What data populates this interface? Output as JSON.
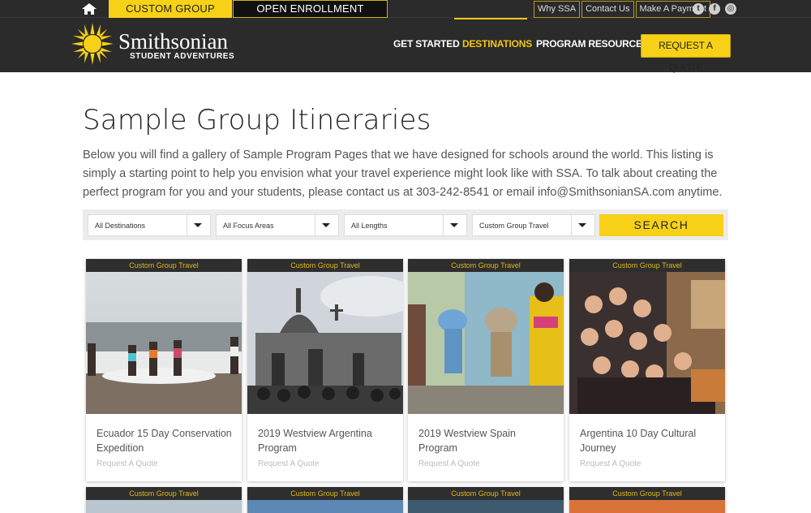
{
  "topbar": {
    "home_icon": "home-icon",
    "tab_custom": "CUSTOM GROUP TRAVEL",
    "tab_open": "OPEN ENROLLMENT PROGRAMS",
    "links": [
      "Why SSA",
      "Contact Us",
      "Make A Payment"
    ],
    "social": [
      {
        "name": "twitter-icon",
        "glyph": "t"
      },
      {
        "name": "facebook-icon",
        "glyph": "f"
      },
      {
        "name": "instagram-icon",
        "glyph": "◎"
      }
    ]
  },
  "header": {
    "logo_name": "Smithsonian",
    "logo_sub": "STUDENT ADVENTURES",
    "nav": [
      "GET STARTED",
      "DESTINATIONS",
      "PROGRAM RESOURCES"
    ],
    "active_nav": "DESTINATIONS",
    "quote_button": "REQUEST A QUOTE"
  },
  "main": {
    "title": "Sample Group Itineraries",
    "intro": "Below you will find a gallery of Sample Program Pages that we have designed for schools around the world. This listing is simply a starting point to help you envision what your travel experience might look like with SSA. To talk about creating the perfect program for you and your students, please contact us at 303-242-8541 or email info@SmithsonianSA.com anytime."
  },
  "filters": {
    "selects": [
      "All Destinations",
      "All Focus Areas",
      "All Lengths",
      "Custom Group Travel"
    ],
    "search_label": "SEARCH"
  },
  "cards": [
    {
      "tag": "Custom Group Travel",
      "title": "Ecuador 15 Day Conservation Expedition",
      "link": "Request A Quote",
      "photo": "beach-photo"
    },
    {
      "tag": "Custom Group Travel",
      "title": "2019 Westview Argentina Program",
      "link": "Request A Quote",
      "photo": "cemetery-photo"
    },
    {
      "tag": "Custom Group Travel",
      "title": "2019 Westview Spain Program",
      "link": "Request A Quote",
      "photo": "smurf-statues-photo"
    },
    {
      "tag": "Custom Group Travel",
      "title": "Argentina 10 Day Cultural Journey",
      "link": "Request A Quote",
      "photo": "group-selfie-photo"
    }
  ],
  "cards_row2": [
    {
      "tag": "Custom Group Travel"
    },
    {
      "tag": "Custom Group Travel"
    },
    {
      "tag": "Custom Group Travel"
    },
    {
      "tag": "Custom Group Travel"
    }
  ],
  "colors": {
    "accent": "#f7d117",
    "header_bg": "#2b2b2b",
    "tag_text": "#e0b81a"
  }
}
